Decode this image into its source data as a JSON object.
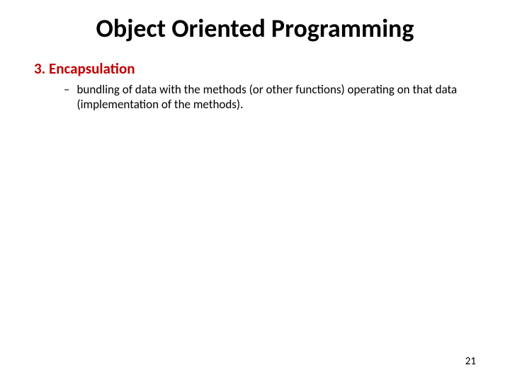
{
  "slide": {
    "title": "Object Oriented Programming",
    "section_heading": "3. Encapsulation",
    "bullet_dash": "–",
    "bullet_text": "bundling of data with the methods (or other functions) operating on that data (implementation of the methods).",
    "page_number": "21"
  }
}
